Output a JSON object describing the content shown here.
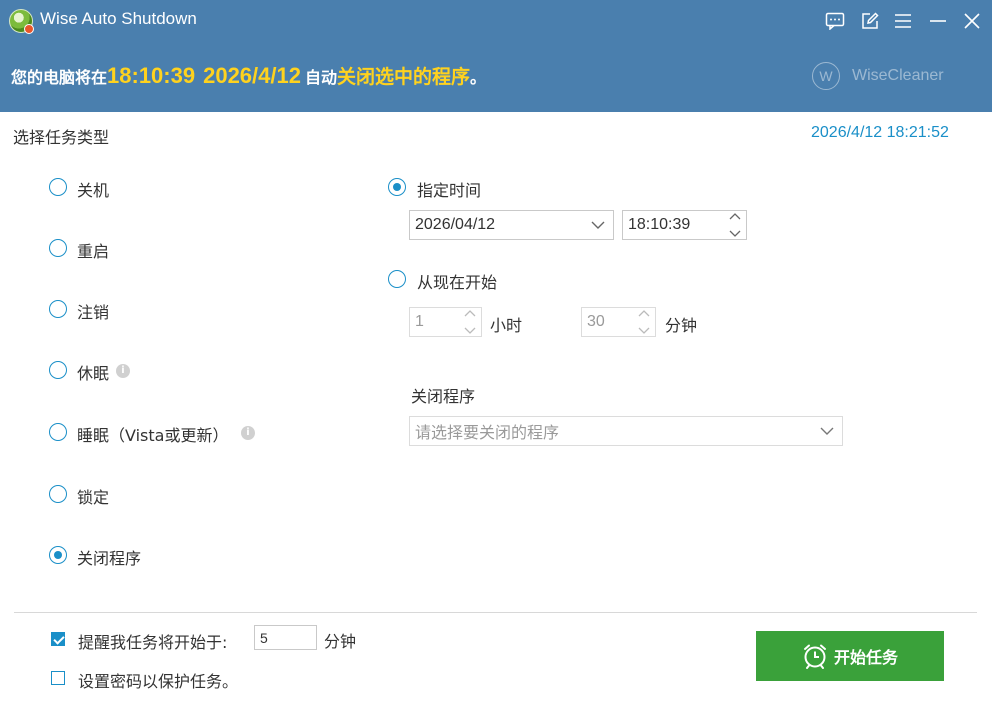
{
  "app": {
    "title": "Wise Auto Shutdown",
    "brand": "WiseCleaner",
    "brand_mark": "W"
  },
  "window_controls": [
    "feedback-icon",
    "edit-icon",
    "menu-icon",
    "minimize-icon",
    "close-icon"
  ],
  "banner": {
    "prefix": "您的电脑将在",
    "time": "18:10:39",
    "date": "2026/4/12",
    "middle": "自动",
    "action": "关闭选中的程序",
    "suffix": "。"
  },
  "task_type": {
    "label": "选择任务类型",
    "current_time": "2026/4/12 18:21:52",
    "options": [
      {
        "label": "关机",
        "checked": false,
        "info": false
      },
      {
        "label": "重启",
        "checked": false,
        "info": false
      },
      {
        "label": "注销",
        "checked": false,
        "info": false
      },
      {
        "label": "休眠",
        "checked": false,
        "info": true
      },
      {
        "label": "睡眠（Vista或更新）",
        "checked": false,
        "info": true
      },
      {
        "label": "锁定",
        "checked": false,
        "info": false
      },
      {
        "label": "关闭程序",
        "checked": true,
        "info": false
      }
    ]
  },
  "schedule": {
    "specified_label": "指定时间",
    "specified_checked": true,
    "date_value": "2026/04/12",
    "time_value": "18:10:39",
    "from_now_label": "从现在开始",
    "from_now_checked": false,
    "hours_value": "1",
    "hours_unit": "小时",
    "minutes_value": "30",
    "minutes_unit": "分钟"
  },
  "close_program": {
    "label": "关闭程序",
    "placeholder": "请选择要关闭的程序"
  },
  "footer": {
    "remind_label": "提醒我任务将开始于:",
    "remind_checked": true,
    "remind_value": "5",
    "remind_unit": "分钟",
    "password_label": "设置密码以保护任务。",
    "password_checked": false,
    "start_label": "开始任务"
  },
  "colors": {
    "titlebar": "#4a7fae",
    "accent": "#1a8fc8",
    "highlight": "#ffd21e",
    "start_button": "#3aa13a"
  }
}
